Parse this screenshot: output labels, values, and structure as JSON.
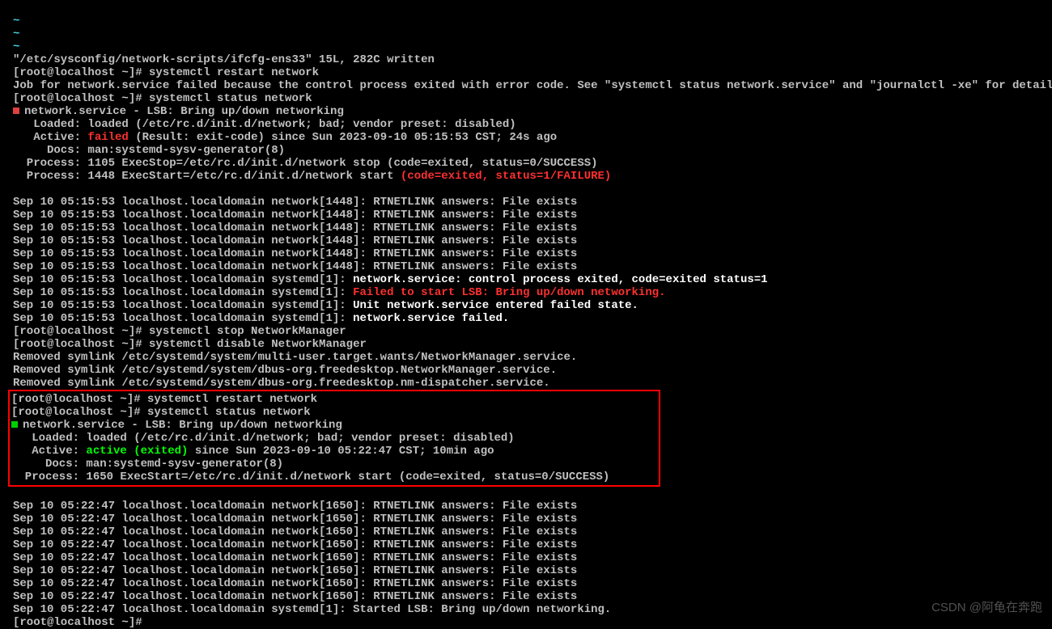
{
  "tildes": [
    "~",
    "~",
    "~"
  ],
  "file_written": "\"/etc/sysconfig/network-scripts/ifcfg-ens33\" 15L, 282C written",
  "prompt": "[root@localhost ~]# ",
  "cmd_restart": "systemctl restart network",
  "cmd_status": "systemctl status network",
  "cmd_stop_nm": "systemctl stop NetworkManager",
  "cmd_disable_nm": "systemctl disable NetworkManager",
  "job_failed": "Job for network.service failed because the control process exited with error code. See \"systemctl status network.service\" and \"journalctl -xe\" for details.",
  "svc_header": "network.service - LSB: Bring up/down networking",
  "loaded": "   Loaded: loaded (/etc/rc.d/init.d/network; bad; vendor preset: disabled)",
  "active_fail_pre": "   Active: ",
  "active_fail_word": "failed",
  "active_fail_post": " (Result: exit-code) since Sun 2023-09-10 05:15:53 CST; 24s ago",
  "docs": "     Docs: man:systemd-sysv-generator(8)",
  "proc_stop": "  Process: 1105 ExecStop=/etc/rc.d/init.d/network stop (code=exited, status=0/SUCCESS)",
  "proc_start_pre": "  Process: 1448 ExecStart=/etc/rc.d/init.d/network start ",
  "proc_start_fail": "(code=exited, status=1/FAILURE)",
  "logs1": [
    "Sep 10 05:15:53 localhost.localdomain network[1448]: RTNETLINK answers: File exists",
    "Sep 10 05:15:53 localhost.localdomain network[1448]: RTNETLINK answers: File exists",
    "Sep 10 05:15:53 localhost.localdomain network[1448]: RTNETLINK answers: File exists",
    "Sep 10 05:15:53 localhost.localdomain network[1448]: RTNETLINK answers: File exists",
    "Sep 10 05:15:53 localhost.localdomain network[1448]: RTNETLINK answers: File exists",
    "Sep 10 05:15:53 localhost.localdomain network[1448]: RTNETLINK answers: File exists"
  ],
  "sys1_pre": "Sep 10 05:15:53 localhost.localdomain systemd[1]: ",
  "sys1_a": "network.service: control process exited, code=exited status=1",
  "sys1_b": "Failed to start LSB: Bring up/down networking.",
  "sys1_c": "Unit network.service entered failed state.",
  "sys1_d": "network.service failed.",
  "removed": [
    "Removed symlink /etc/systemd/system/multi-user.target.wants/NetworkManager.service.",
    "Removed symlink /etc/systemd/system/dbus-org.freedesktop.NetworkManager.service.",
    "Removed symlink /etc/systemd/system/dbus-org.freedesktop.nm-dispatcher.service."
  ],
  "active_ok_pre": "   Active: ",
  "active_ok_word": "active (exited)",
  "active_ok_post": " since Sun 2023-09-10 05:22:47 CST; 10min ago",
  "proc_start_ok": "  Process: 1650 ExecStart=/etc/rc.d/init.d/network start (code=exited, status=0/SUCCESS)",
  "logs2": [
    "Sep 10 05:22:47 localhost.localdomain network[1650]: RTNETLINK answers: File exists",
    "Sep 10 05:22:47 localhost.localdomain network[1650]: RTNETLINK answers: File exists",
    "Sep 10 05:22:47 localhost.localdomain network[1650]: RTNETLINK answers: File exists",
    "Sep 10 05:22:47 localhost.localdomain network[1650]: RTNETLINK answers: File exists",
    "Sep 10 05:22:47 localhost.localdomain network[1650]: RTNETLINK answers: File exists",
    "Sep 10 05:22:47 localhost.localdomain network[1650]: RTNETLINK answers: File exists",
    "Sep 10 05:22:47 localhost.localdomain network[1650]: RTNETLINK answers: File exists",
    "Sep 10 05:22:47 localhost.localdomain network[1650]: RTNETLINK answers: File exists"
  ],
  "started_line": "Sep 10 05:22:47 localhost.localdomain systemd[1]: Started LSB: Bring up/down networking.",
  "watermark": "CSDN @阿龟在奔跑"
}
